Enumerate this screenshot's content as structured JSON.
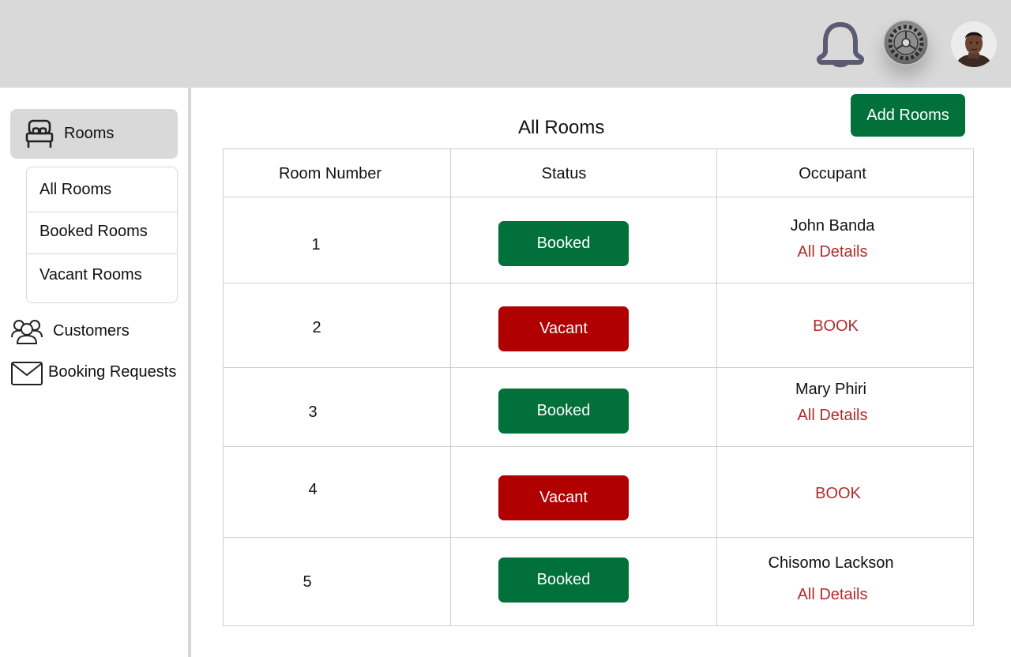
{
  "sidebar": {
    "rooms_label": "Rooms",
    "submenu": [
      "All Rooms",
      "Booked Rooms",
      "Vacant Rooms"
    ],
    "customers_label": "Customers",
    "booking_requests_label": "Booking Requests"
  },
  "header": {
    "icons": [
      "bell-icon",
      "settings-gear-icon",
      "user-avatar"
    ]
  },
  "main": {
    "title": "All Rooms",
    "add_button": "Add Rooms",
    "columns": [
      "Room Number",
      "Status",
      "Occupant"
    ],
    "rows": [
      {
        "room": "1",
        "status": "Booked",
        "occupant": "John Banda",
        "action": "All Details"
      },
      {
        "room": "2",
        "status": "Vacant",
        "occupant": "",
        "action": "BOOK"
      },
      {
        "room": "3",
        "status": "Booked",
        "occupant": "Mary Phiri",
        "action": "All Details"
      },
      {
        "room": "4",
        "status": "Vacant",
        "occupant": "",
        "action": "BOOK"
      },
      {
        "room": "5",
        "status": "Booked",
        "occupant": "Chisomo Lackson",
        "action": "All Details"
      }
    ]
  },
  "colors": {
    "topbar": "#d9d9d9",
    "booked": "#01703b",
    "vacant": "#b00000",
    "link": "#b32a2a"
  }
}
